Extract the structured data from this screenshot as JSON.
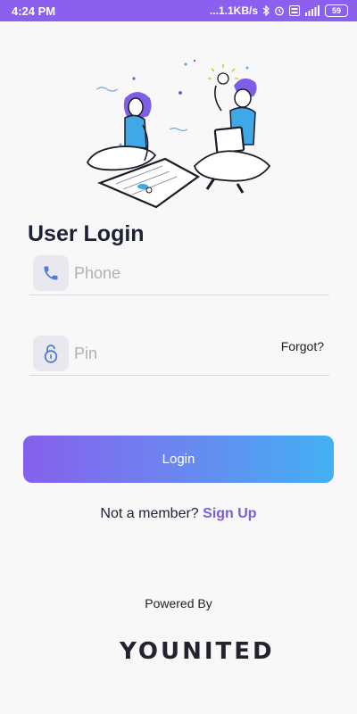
{
  "status_bar": {
    "time": "4:24 PM",
    "network_speed": "1.1KB/s",
    "battery": "59",
    "icons": [
      "bluetooth-icon",
      "alarm-icon",
      "volte-icon",
      "signal-icon",
      "battery-icon"
    ]
  },
  "login": {
    "title": "User Login",
    "phone_placeholder": "Phone",
    "pin_placeholder": "Pin",
    "forgot_label": "Forgot?",
    "login_label": "Login",
    "not_member_text": "Not a member?",
    "signup_label": "Sign Up"
  },
  "footer": {
    "powered_by": "Powered By",
    "brand_name": "YOUNITED"
  },
  "colors": {
    "status_bar": "#8b60ee",
    "button_start": "#8660ec",
    "button_end": "#42b0f3",
    "link": "#7b5ddc",
    "title": "#1e2035"
  }
}
